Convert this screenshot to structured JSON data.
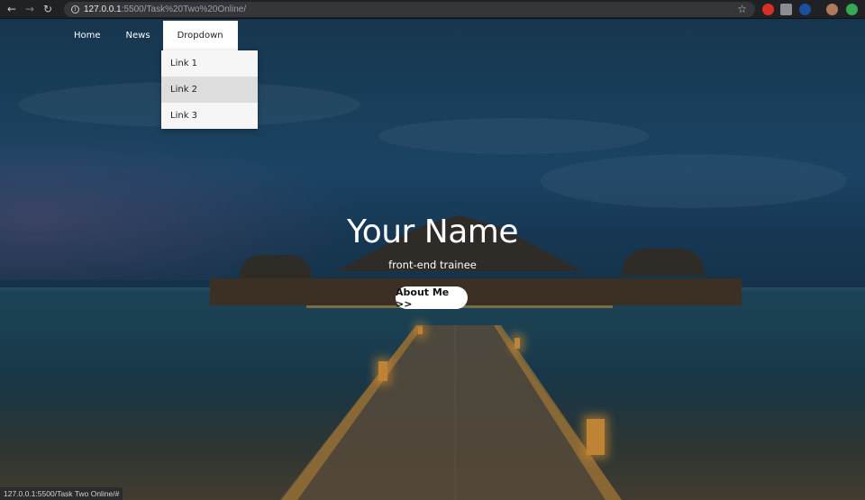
{
  "browser": {
    "url_host": "127.0.0.1",
    "url_rest": ":5500/Task%20Two%20Online/",
    "status_url": "127.0.0.1:5500/Task Two Online/#"
  },
  "nav": {
    "items": [
      {
        "label": "Home"
      },
      {
        "label": "News"
      },
      {
        "label": "Dropdown"
      }
    ],
    "dropdown": [
      {
        "label": "Link 1"
      },
      {
        "label": "Link 2"
      },
      {
        "label": "Link 3"
      }
    ]
  },
  "hero": {
    "title": "Your Name",
    "subtitle": "front-end trainee",
    "button_label": "About Me >>"
  },
  "colors": {
    "accent": "#ffffff",
    "dropdown_bg": "#f6f6f6",
    "dropdown_hover": "#dddddd"
  }
}
